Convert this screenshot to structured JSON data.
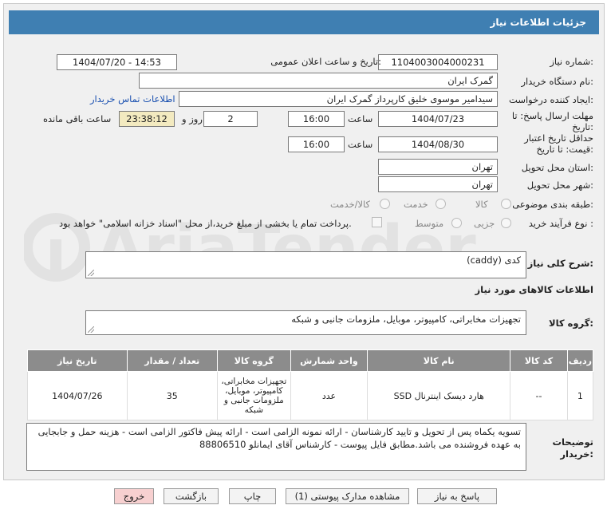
{
  "title": "جزئیات اطلاعات نیاز",
  "fields": {
    "need_number_label": "شماره نیاز:",
    "need_number": "1104003004000231",
    "announce_label": "تاریخ و ساعت اعلان عمومی:",
    "announce_value": "1404/07/20 - 14:53",
    "buyer_org_label": "نام دستگاه خریدار:",
    "buyer_org": "گمرک ایران",
    "creator_label": "ایجاد کننده درخواست:",
    "creator": "سیدامیر موسوی خلیق کارپرداز گمرک ایران",
    "contact_link": "اطلاعات تماس خریدار",
    "deadline_label_1": "مهلت ارسال پاسخ: تا",
    "deadline_label_2": "تاریخ:",
    "deadline_date": "1404/07/23",
    "time_word": "ساعت",
    "deadline_time": "16:00",
    "days_value": "2",
    "days_word": "روز و",
    "remaining_time": "23:38:12",
    "remaining_word": "ساعت باقی مانده",
    "validity_label_1": "حداقل تاریخ اعتبار",
    "validity_label_2": "قیمت: تا تاریخ:",
    "validity_date": "1404/08/30",
    "validity_time": "16:00",
    "province_label": "استان محل تحویل:",
    "province": "تهران",
    "city_label": "شهر محل تحویل:",
    "city": "تهران",
    "category_label": "طبقه بندی موضوعی:",
    "category_options": [
      "کالا",
      "خدمت",
      "کالا/خدمت"
    ],
    "process_label": "نوع فرآیند خرید :",
    "process_options": [
      "جزیی",
      "متوسط"
    ],
    "payment_note": "پرداخت تمام یا بخشی از مبلغ خرید،از محل \"اسناد خزانه اسلامی\" خواهد بود."
  },
  "summary": {
    "label": "شرح کلی نیاز:",
    "value": "کدی (caddy)"
  },
  "goods_section_title": "اطلاعات کالاهای مورد نیاز",
  "goods_group": {
    "label": "گروه کالا:",
    "value": "تجهیزات مخابراتی، کامپیوتر، موبایل، ملزومات جانبی و شبکه"
  },
  "table": {
    "headers": [
      "ردیف",
      "کد کالا",
      "نام کالا",
      "واحد شمارش",
      "گروه کالا",
      "تعداد / مقدار",
      "تاریخ نیاز"
    ],
    "rows": [
      [
        "1",
        "--",
        "هارد دیسک اینترنال SSD",
        "عدد",
        "تجهیزات مخابراتی، کامپیوتر، موبایل، ملزومات جانبی و شبکه",
        "35",
        "1404/07/26"
      ]
    ]
  },
  "buyer_notes": {
    "label_1": "توضیحات",
    "label_2": "خریدار:",
    "value": "تسویه یکماه پس از تحویل و تایید کارشناسان - ارائه نمونه الزامی است - ارائه پیش فاکتور الزامی است - هزینه حمل و جابجایی به عهده فروشنده می باشد.مطابق فایل پیوست - کارشناس آقای ایمانلو 88806510"
  },
  "buttons": {
    "reply": "پاسخ به نیاز",
    "attachments": "مشاهده مدارک پیوستی (1)",
    "print": "چاپ",
    "back": "بازگشت",
    "exit": "خروج"
  },
  "watermark": "AriaTender.net",
  "colors": {
    "header": "#3f7fb2",
    "table_header": "#8c8c8c",
    "remaining_bg": "#f3eac0",
    "exit_bg": "#f7d0d0"
  }
}
